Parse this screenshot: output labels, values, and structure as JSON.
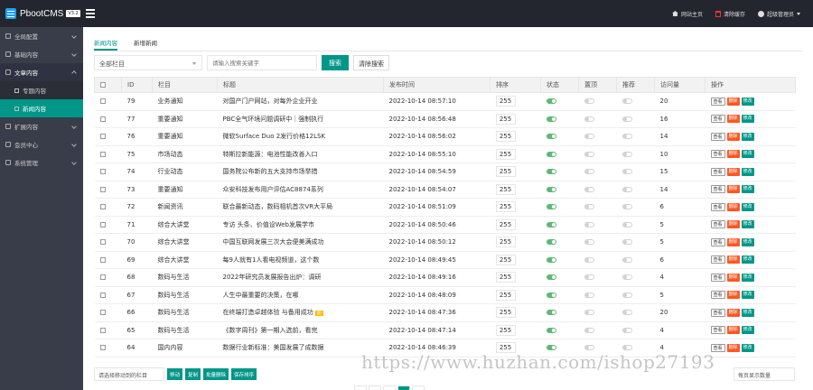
{
  "app": {
    "name": "PbootCMS",
    "version": "V3.2"
  },
  "top_links": [
    {
      "label": "网站主页"
    },
    {
      "label": "清除缓存"
    },
    {
      "label": "超级管理员"
    }
  ],
  "sidebar": [
    {
      "label": "全局配置",
      "open": false
    },
    {
      "label": "基础内容",
      "open": false
    },
    {
      "label": "文章内容",
      "open": true
    },
    {
      "label": "专题内容",
      "sub": true,
      "active": false
    },
    {
      "label": "新闻内容",
      "sub": true,
      "active": true
    },
    {
      "label": "扩展内容",
      "open": false
    },
    {
      "label": "会员中心",
      "open": false
    },
    {
      "label": "系统管理",
      "open": false
    }
  ],
  "tabs": [
    "新闻内容",
    "新增新闻"
  ],
  "filter": {
    "column_select": "全部栏目",
    "keyword_placeholder": "请输入搜索关键字",
    "search_label": "搜索",
    "clear_label": "清除搜索"
  },
  "table": {
    "headers": [
      "",
      "ID",
      "栏目",
      "标题",
      "发布时间",
      "排序",
      "状态",
      "置顶",
      "推荐",
      "访问量",
      "操作"
    ],
    "rows": [
      {
        "id": "79",
        "cat": "业务通知",
        "title": "对国产门户网站，对每外企业开业",
        "time": "2022-10-14 08:57:10",
        "sort": "255",
        "status": true,
        "top": false,
        "rec": false,
        "views": "20",
        "tag": ""
      },
      {
        "id": "77",
        "cat": "重要通知",
        "title": "PBC全气环境问题调研中｜强制执行",
        "time": "2022-10-14 08:56:48",
        "sort": "255",
        "status": true,
        "top": false,
        "rec": false,
        "views": "16",
        "tag": ""
      },
      {
        "id": "76",
        "cat": "重要通知",
        "title": "微软Surface Duo 2发行价格12LSK",
        "time": "2022-10-14 08:56:02",
        "sort": "255",
        "status": true,
        "top": false,
        "rec": false,
        "views": "14",
        "tag": ""
      },
      {
        "id": "75",
        "cat": "市场动态",
        "title": "特斯拉新能源：电池性能改善入口",
        "time": "2022-10-14 08:55:10",
        "sort": "255",
        "status": true,
        "top": false,
        "rec": false,
        "views": "10",
        "tag": ""
      },
      {
        "id": "74",
        "cat": "行业动态",
        "title": "国务院公布新的五大支持市场举措",
        "time": "2022-10-14 08:54:59",
        "sort": "255",
        "status": true,
        "top": false,
        "rec": false,
        "views": "15",
        "tag": ""
      },
      {
        "id": "73",
        "cat": "重要通知",
        "title": "众安科技发布用户评估AC8874系列",
        "time": "2022-10-14 08:54:07",
        "sort": "255",
        "status": true,
        "top": false,
        "rec": false,
        "views": "14",
        "tag": ""
      },
      {
        "id": "72",
        "cat": "新闻资讯",
        "title": "联合最新动态，数码相机首次VR大平局",
        "time": "2022-10-14 08:51:09",
        "sort": "255",
        "status": true,
        "top": false,
        "rec": false,
        "views": "6",
        "tag": ""
      },
      {
        "id": "71",
        "cat": "综合大讲堂",
        "title": "专访 头条、价值设Web发展学市",
        "time": "2022-10-14 08:50:46",
        "sort": "255",
        "status": true,
        "top": false,
        "rec": false,
        "views": "5",
        "tag": ""
      },
      {
        "id": "70",
        "cat": "综合大讲堂",
        "title": "中国互联网发展三次大会便美满成功",
        "time": "2022-10-14 08:50:12",
        "sort": "255",
        "status": true,
        "top": false,
        "rec": false,
        "views": "5",
        "tag": ""
      },
      {
        "id": "69",
        "cat": "综合大讲堂",
        "title": "每9人就有1人看电视频道，这个数",
        "time": "2022-10-14 08:49:45",
        "sort": "255",
        "status": true,
        "top": false,
        "rec": false,
        "views": "6",
        "tag": ""
      },
      {
        "id": "68",
        "cat": "数码与生活",
        "title": "2022年研究员发展报告出炉：调研",
        "time": "2022-10-14 08:49:16",
        "sort": "255",
        "status": true,
        "top": false,
        "rec": false,
        "views": "4",
        "tag": ""
      },
      {
        "id": "67",
        "cat": "数码与生活",
        "title": "人生中最重要的决策，在哪",
        "time": "2022-10-14 08:48:09",
        "sort": "255",
        "status": true,
        "top": false,
        "rec": false,
        "views": "5",
        "tag": ""
      },
      {
        "id": "66",
        "cat": "数码与生活",
        "title": "在终端打造卓越体验 与备用成功",
        "time": "2022-10-14 08:47:36",
        "sort": "255",
        "status": true,
        "top": false,
        "rec": false,
        "views": "20",
        "tag": "图"
      },
      {
        "id": "65",
        "cat": "数码与生活",
        "title": "《数字周刊》第一期入选前，看完",
        "time": "2022-10-14 08:47:14",
        "sort": "255",
        "status": true,
        "top": false,
        "rec": false,
        "views": "4",
        "tag": ""
      },
      {
        "id": "64",
        "cat": "国内内容",
        "title": "数据行业新标准：美国发展了成数据",
        "time": "2022-10-14 08:46:39",
        "sort": "255",
        "status": true,
        "top": false,
        "rec": false,
        "views": "4",
        "tag": ""
      }
    ],
    "ops": {
      "view": "查看",
      "del": "删除",
      "edit": "修改"
    }
  },
  "footer": {
    "batch_select": "请选择移动到的栏目",
    "buttons": [
      "移动",
      "复制",
      "批量删除",
      "保存排序"
    ],
    "per_page": "每页显示数量"
  },
  "watermark": "https://www.huzhan.com/ishop27193"
}
